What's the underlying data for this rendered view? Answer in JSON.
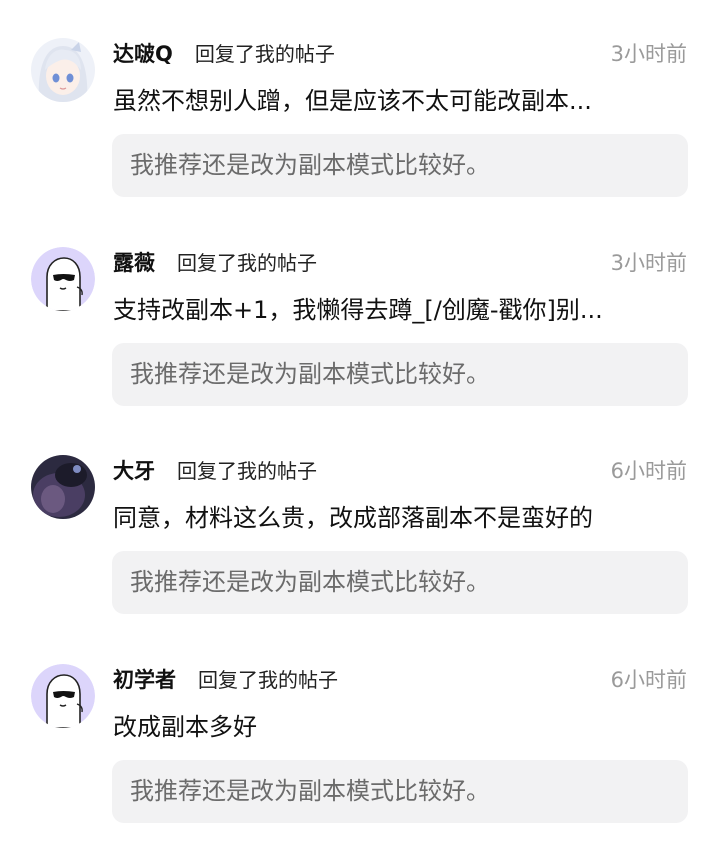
{
  "comments": [
    {
      "user": "达啵Q",
      "action": "回复了我的帖子",
      "time": "3小时前",
      "content": "虽然不想别人蹭，但是应该不太可能改副本...",
      "quote": "我推荐还是改为副本模式比较好。",
      "avatar": "anime-girl-avatar"
    },
    {
      "user": "露薇",
      "action": "回复了我的帖子",
      "time": "3小时前",
      "content": "支持改副本+1，我懒得去蹲_[/创魔-戳你]别...",
      "quote": "我推荐还是改为副本模式比较好。",
      "avatar": "sunglasses-ghost-avatar"
    },
    {
      "user": "大牙",
      "action": "回复了我的帖子",
      "time": "6小时前",
      "content": "同意，材料这么贵，改成部落副本不是蛮好的",
      "quote": "我推荐还是改为副本模式比较好。",
      "avatar": "dark-photo-avatar"
    },
    {
      "user": "初学者",
      "action": "回复了我的帖子",
      "time": "6小时前",
      "content": "改成副本多好",
      "quote": "我推荐还是改为副本模式比较好。",
      "avatar": "sunglasses-ghost-avatar"
    }
  ]
}
